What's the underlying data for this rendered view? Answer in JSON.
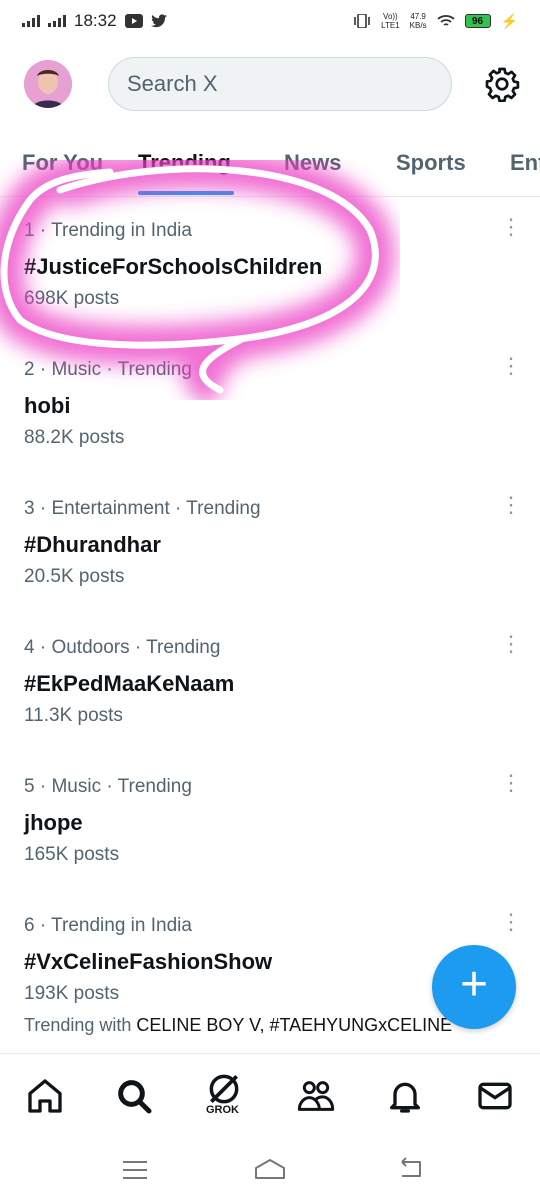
{
  "status_bar": {
    "time": "18:32",
    "net_label_top": "Vo))",
    "net_label_bottom": "LTE1",
    "speed_top": "47.9",
    "speed_bottom": "KB/s",
    "battery": "96"
  },
  "header": {
    "search_placeholder": "Search X"
  },
  "tabs": [
    {
      "label": "For You"
    },
    {
      "label": "Trending"
    },
    {
      "label": "News"
    },
    {
      "label": "Sports"
    },
    {
      "label": "Ent"
    }
  ],
  "trends": [
    {
      "meta": "1 · Trending in India",
      "name": "#JusticeForSchoolsChildren",
      "count": "698K posts"
    },
    {
      "meta": "2 · Music · Trending",
      "name": "hobi",
      "count": "88.2K posts"
    },
    {
      "meta": "3 · Entertainment · Trending",
      "name": "#Dhurandhar",
      "count": "20.5K posts"
    },
    {
      "meta": "4 · Outdoors · Trending",
      "name": "#EkPedMaaKeNaam",
      "count": "11.3K posts"
    },
    {
      "meta": "5 · Music · Trending",
      "name": "jhope",
      "count": "165K posts"
    },
    {
      "meta": "6 · Trending in India",
      "name": "#VxCelineFashionShow",
      "count": "193K posts",
      "with_prefix": "Trending with ",
      "with_terms": "CELINE BOY V, #TAEHYUNGxCELINE"
    }
  ],
  "fab": {
    "label": "+"
  },
  "bottom_nav": {
    "grok_label": "GROK"
  },
  "colors": {
    "accent": "#1d9bf0",
    "annotation": "#e040c0"
  }
}
